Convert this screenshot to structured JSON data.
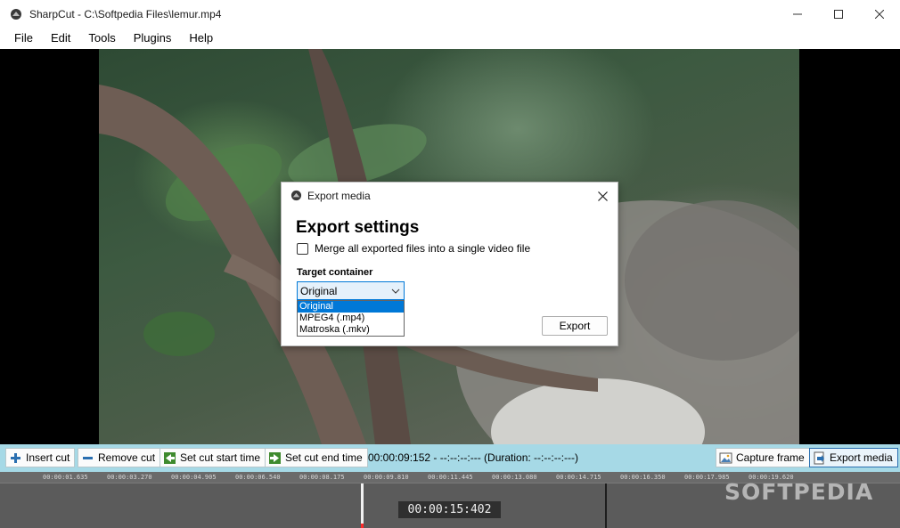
{
  "window": {
    "title": "SharpCut - C:\\Softpedia Files\\lemur.mp4",
    "controls": [
      "minimize-icon",
      "maximize-icon",
      "close-icon"
    ]
  },
  "menu": [
    "File",
    "Edit",
    "Tools",
    "Plugins",
    "Help"
  ],
  "dialog": {
    "title": "Export media",
    "heading": "Export settings",
    "merge_label": "Merge all exported files into a single video file",
    "merge_checked": false,
    "target_label": "Target container",
    "selected_value": "Original",
    "options": [
      "Original",
      "MPEG4 (.mp4)",
      "Matroska (.mkv)"
    ],
    "export_label": "Export"
  },
  "toolbar": {
    "insert_cut": "Insert cut",
    "remove_cut": "Remove cut",
    "set_cut_start": "Set cut start time",
    "set_cut_end": "Set cut end time",
    "status": "00:00:09:152 - --:--:--:--- (Duration: --:--:--:---)",
    "capture_frame": "Capture frame",
    "export_media": "Export media"
  },
  "timeline": {
    "ticks": [
      "00:00:01.635",
      "00:00:03.270",
      "00:00:04.905",
      "00:00:06.540",
      "00:00:08.175",
      "00:00:09.810",
      "00:00:11.445",
      "00:00:13.080",
      "00:00:14.715",
      "00:00:16.350",
      "00:00:17.985",
      "00:00:19.620"
    ],
    "current_time": "00:00:15:402"
  },
  "watermark": "SOFTPEDIA",
  "colors": {
    "toolbar_bg": "#a6d9e6",
    "accent": "#0078d7",
    "timeline_bg": "#5b5b5b"
  }
}
